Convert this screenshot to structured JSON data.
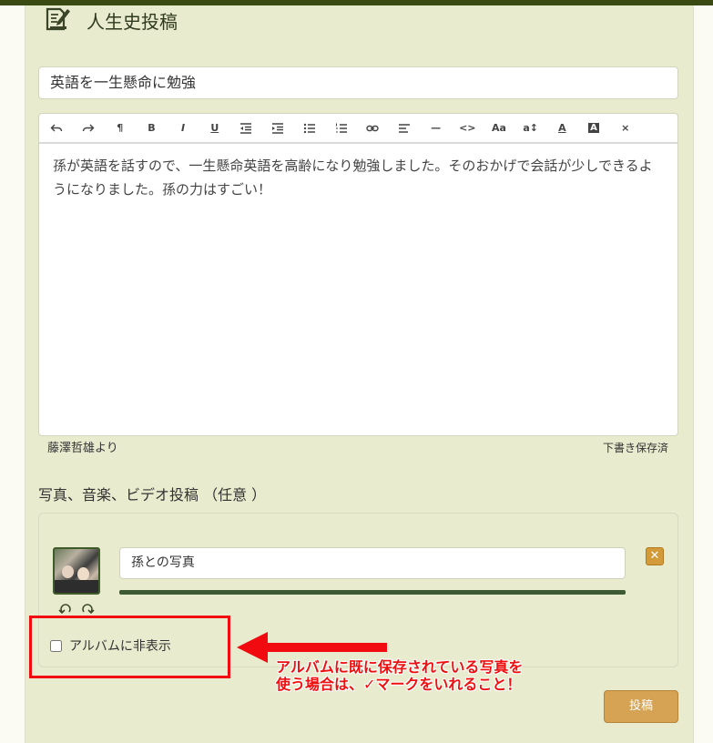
{
  "header": {
    "title": "人生史投稿",
    "icon": "edit-document-icon"
  },
  "title_field": {
    "value": "英語を一生懸命に勉強"
  },
  "editor": {
    "toolbar": [
      {
        "name": "undo-icon",
        "label": ""
      },
      {
        "name": "redo-icon",
        "label": ""
      },
      {
        "name": "paragraph-icon",
        "label": "¶"
      },
      {
        "name": "bold-icon",
        "label": "B"
      },
      {
        "name": "italic-icon",
        "label": "I"
      },
      {
        "name": "underline-icon",
        "label": "U"
      },
      {
        "name": "outdent-icon",
        "label": ""
      },
      {
        "name": "indent-icon",
        "label": ""
      },
      {
        "name": "bullet-list-icon",
        "label": ""
      },
      {
        "name": "numbered-list-icon",
        "label": ""
      },
      {
        "name": "link-icon",
        "label": ""
      },
      {
        "name": "align-icon",
        "label": ""
      },
      {
        "name": "horizontal-rule-icon",
        "label": "—"
      },
      {
        "name": "code-icon",
        "label": "<>"
      },
      {
        "name": "font-size-icon",
        "label": "Aa"
      },
      {
        "name": "line-height-icon",
        "label": "a↕"
      },
      {
        "name": "text-color-icon",
        "label": "A"
      },
      {
        "name": "background-color-icon",
        "label": "A"
      },
      {
        "name": "clear-format-icon",
        "label": "×"
      }
    ],
    "body": "孫が英語を話すので、一生懸命英語を高齢になり勉強しました。そのおかげで会話が少しできるようになりました。孫の力はすごい！"
  },
  "footer": {
    "author": "藤澤哲雄より",
    "draft_status": "下書き保存済"
  },
  "media": {
    "heading": "写真、音楽、ビデオ投稿 （任意 ）",
    "items": [
      {
        "caption": "孫との写真",
        "upload_progress": 1.0
      }
    ],
    "hide_from_album_label": "アルバムに非表示",
    "hide_from_album_checked": false
  },
  "annotation": {
    "text": "アルバムに既に保存されている写真を\n使う場合は、✓マークをいれること！"
  },
  "submit_label": "投稿",
  "colors": {
    "accent": "#d6a355",
    "panel": "#e8ebce",
    "highlight": "#f10a10",
    "progress": "#3e5a34"
  }
}
